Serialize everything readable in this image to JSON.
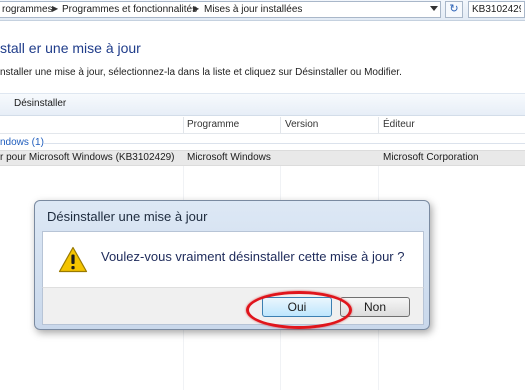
{
  "address_bar": {
    "crumbs": [
      "rogrammes",
      "Programmes et fonctionnalités",
      "Mises à jour installées"
    ],
    "search_value": "KB3102429",
    "refresh_icon": "refresh-icon"
  },
  "page": {
    "title": "stall er une mise à jour",
    "description": "nstaller une mise à jour, sélectionnez-la dans la liste et cliquez sur Désinstaller ou Modifier."
  },
  "toolbar": {
    "uninstall_label": "Désinstaller"
  },
  "list": {
    "columns": [
      "Programme",
      "Version",
      "Éditeur"
    ],
    "group_label": "ndows (1)",
    "rows": [
      {
        "name": "r pour Microsoft Windows (KB3102429)",
        "program": "Microsoft Windows",
        "version": "",
        "publisher": "Microsoft Corporation"
      }
    ]
  },
  "dialog": {
    "title": "Désinstaller une mise à jour",
    "message": "Voulez-vous vraiment désinstaller cette mise à jour ?",
    "yes_label": "Oui",
    "no_label": "Non",
    "icon": "warning-icon",
    "highlight_color": "#e0151c"
  }
}
